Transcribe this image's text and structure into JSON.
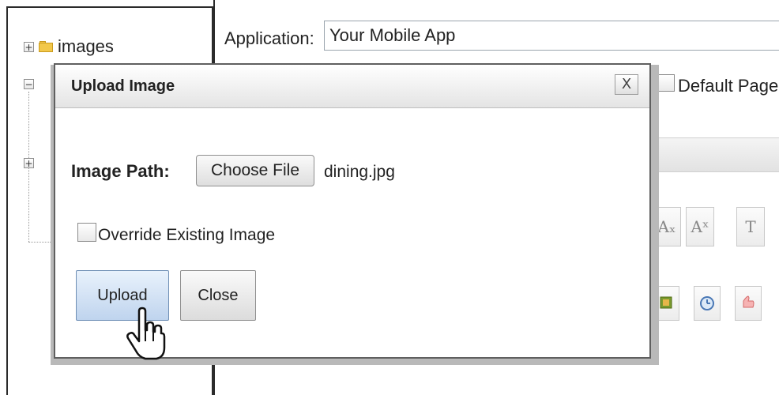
{
  "tree": {
    "nodes": [
      {
        "label": "images",
        "expander": "+"
      },
      {
        "label": "",
        "expander": "−"
      },
      {
        "label": "",
        "expander": "+"
      }
    ]
  },
  "editor": {
    "application_label": "Application:",
    "application_value": "Your Mobile App",
    "default_page_label": "Default Page",
    "format_buttons": [
      "Aₓ",
      "Aˣ",
      "T"
    ]
  },
  "dialog": {
    "title": "Upload Image",
    "close_glyph": "X",
    "image_path_label": "Image Path:",
    "choose_file_label": "Choose File",
    "selected_file": "dining.jpg",
    "override_label": "Override Existing Image",
    "override_checked": false,
    "upload_label": "Upload",
    "close_label": "Close"
  },
  "icons": {
    "tree_folder": "folder-icon",
    "cursor": "hand-pointer-icon",
    "toolbar_icons": [
      "image-icon",
      "clock-icon",
      "thumb-icon"
    ]
  },
  "colors": {
    "folder": "#f2c84b",
    "upload_button_bg": "#bfd4ee",
    "modal_border": "#5f5f5f"
  }
}
